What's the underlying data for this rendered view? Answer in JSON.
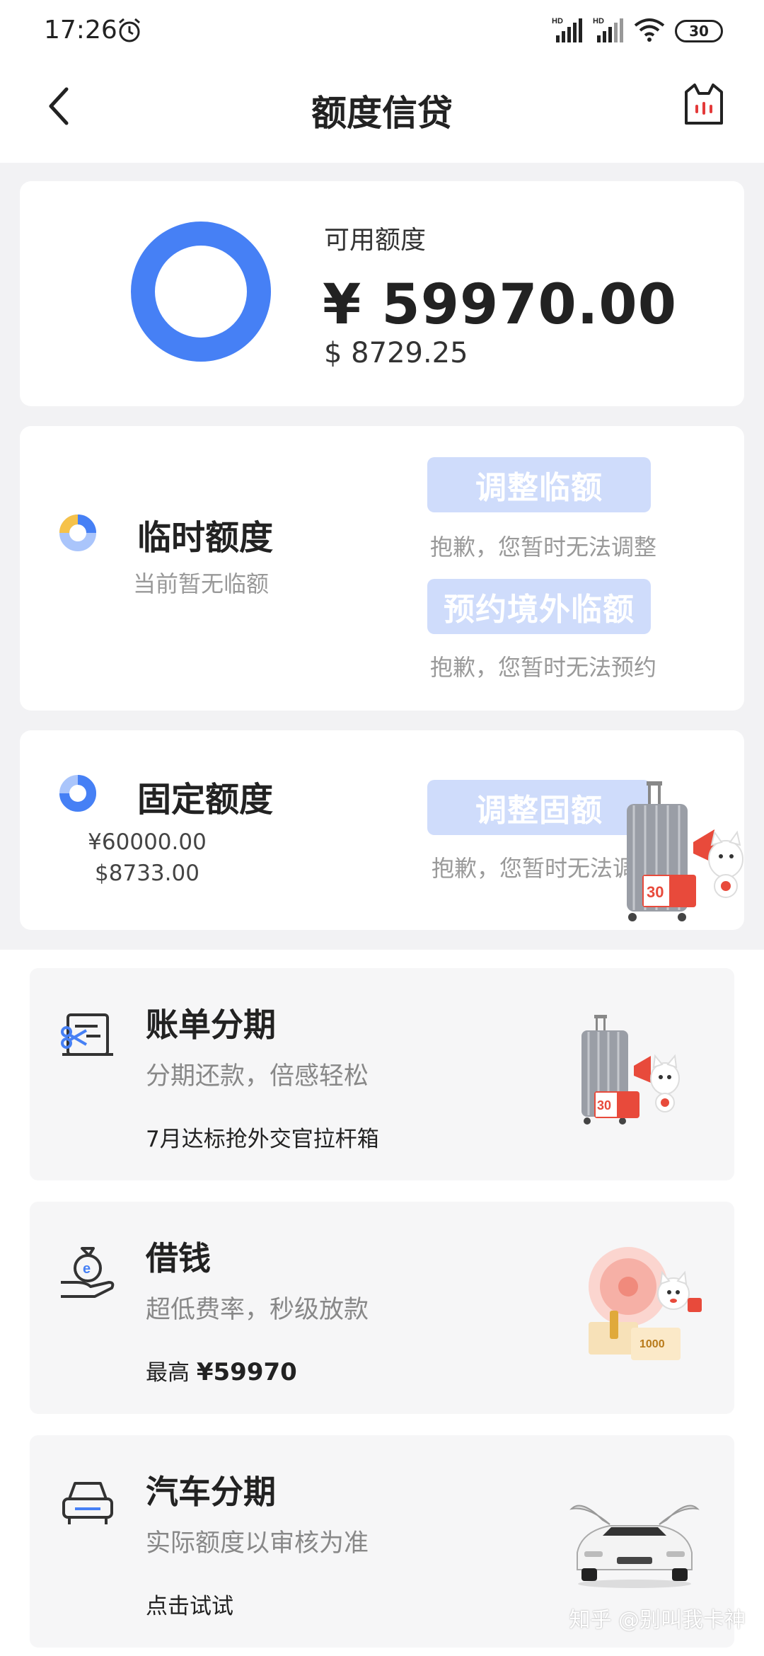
{
  "status_bar": {
    "time": "17:26",
    "alarm_icon": "alarm-clock-icon",
    "signal_1_label": "HD",
    "signal_2_label": "HD",
    "wifi_icon": "wifi-icon",
    "battery_level": "30"
  },
  "header": {
    "title": "额度信贷",
    "back_icon": "chevron-left-icon",
    "mascot_icon": "cat-mascot-icon"
  },
  "available_credit": {
    "label": "可用额度",
    "amount_cny": "¥ 59970.00",
    "amount_usd": "$ 8729.25",
    "ring_color": "#4680f5"
  },
  "temporary_credit": {
    "title": "临时额度",
    "subtitle": "当前暂无临额",
    "adjust_button": "调整临额",
    "adjust_note": "抱歉，您暂时无法调整",
    "reserve_button": "预约境外临额",
    "reserve_note": "抱歉，您暂时无法预约"
  },
  "fixed_credit": {
    "title": "固定额度",
    "amount_cny": "¥60000.00",
    "amount_usd": "$8733.00",
    "adjust_button": "调整固额",
    "adjust_note": "抱歉，您暂时无法调"
  },
  "promo_badge_text": "30",
  "features": [
    {
      "icon": "bill-scissors-icon",
      "title": "账单分期",
      "subtitle": "分期还款，倍感轻松",
      "footer": "7月达标抢外交官拉杆箱",
      "badge": "30"
    },
    {
      "icon": "money-bag-hand-icon",
      "title": "借钱",
      "subtitle": "超低费率，秒级放款",
      "footer_prefix": "最高",
      "footer_value": "¥59970",
      "coupon": "1000"
    },
    {
      "icon": "car-icon",
      "title": "汽车分期",
      "subtitle": "实际额度以审核为准",
      "footer": "点击试试"
    }
  ],
  "watermark": "知乎 @别叫我卡神",
  "colors": {
    "accent_blue": "#4680f5",
    "button_disabled": "#cfdcfb",
    "pie_yellow": "#f6c24a",
    "mascot_red": "#e33a3a"
  }
}
